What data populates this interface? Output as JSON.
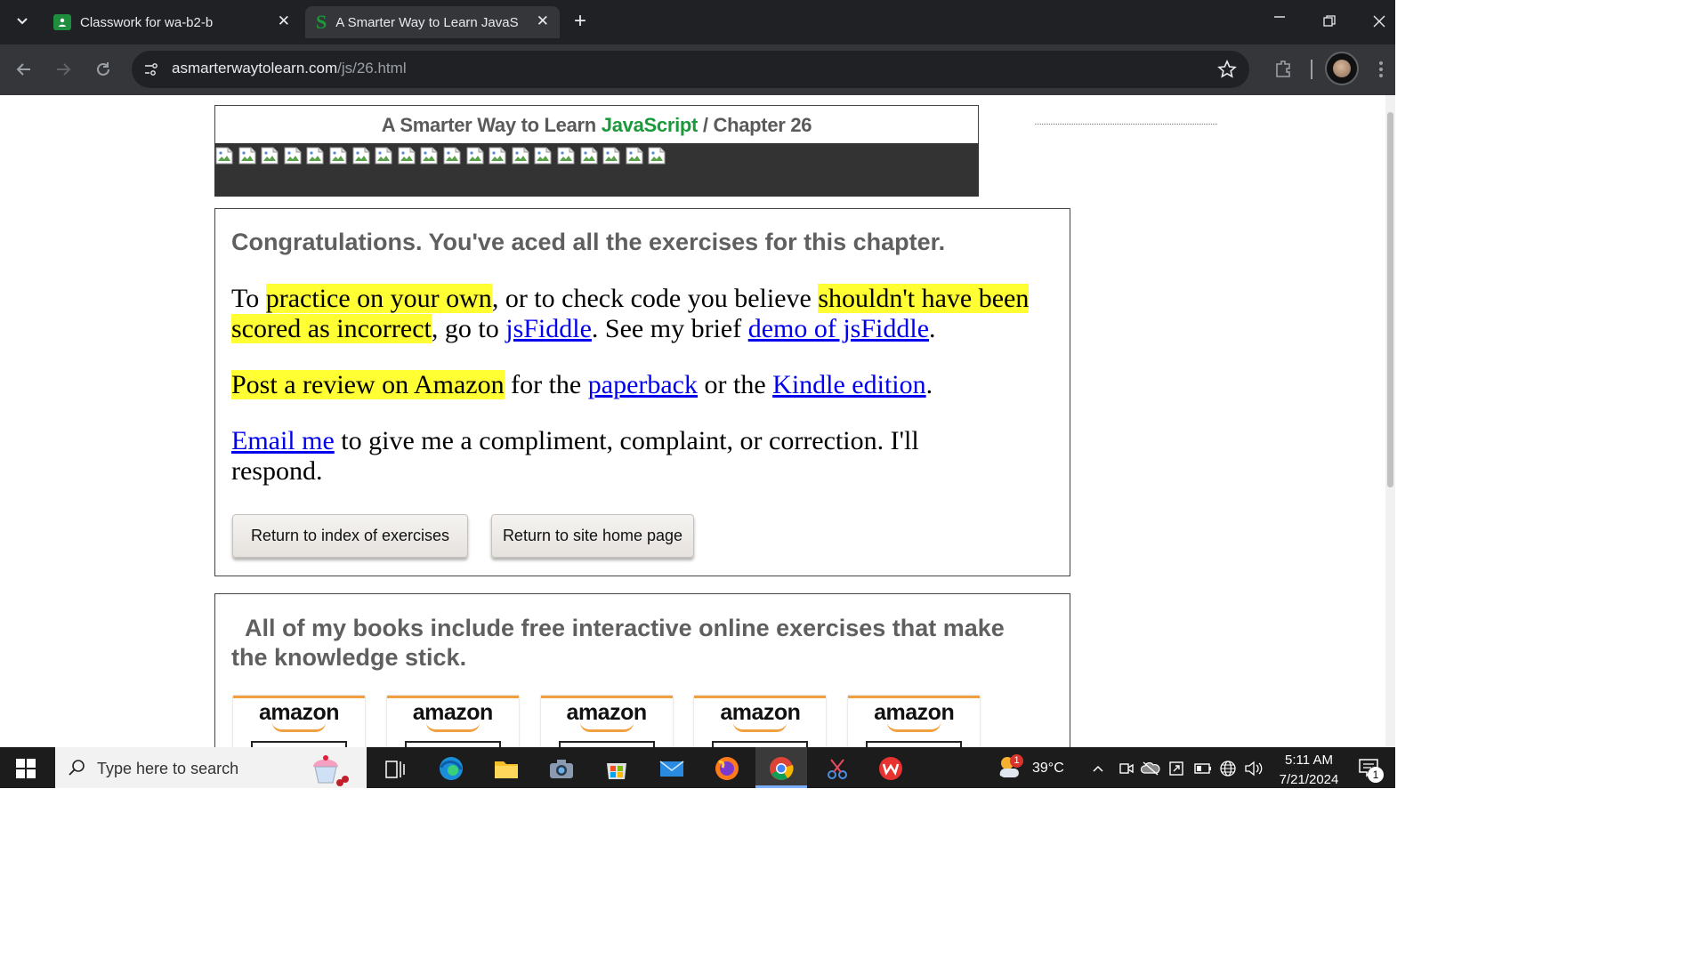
{
  "browser": {
    "tabs": [
      {
        "title": "Classwork for wa-b2-b",
        "close": "✕"
      },
      {
        "title": "A Smarter Way to Learn JavaScri",
        "close": "✕"
      }
    ],
    "new_tab": "+",
    "url_domain": "asmarterwaytolearn.com",
    "url_path": "/js/26.html"
  },
  "header": {
    "prefix": "A Smarter Way to Learn ",
    "brand": "JavaScript",
    "separator": " / ",
    "chapter": "Chapter 26",
    "brand_color": "#1a9a3a"
  },
  "result": {
    "heading": "Congratulations. You've aced all the exercises for this chapter.",
    "p1_a": "To ",
    "p1_hl1": "practice on your own",
    "p1_b": ", or to check code you believe ",
    "p1_hl2": "shouldn't have been scored as incorrect",
    "p1_c": ", go to ",
    "p1_link1": "jsFiddle",
    "p1_d": ". See my brief ",
    "p1_link2": "demo of jsFiddle",
    "p1_e": ".",
    "p2_hl": "Post a review on Amazon",
    "p2_a": " for the ",
    "p2_link1": "paperback",
    "p2_b": " or the ",
    "p2_link2": "Kindle edition",
    "p2_c": ".",
    "p3_link": "Email me",
    "p3_a": " to give me a compliment, complaint, or correction. I'll respond.",
    "btn_index": "Return to index of exercises",
    "btn_home": "Return to site home page"
  },
  "books": {
    "heading": "All of my books include free interactive online exercises that make the knowledge stick.",
    "store_label": "amazon",
    "store_count": 5
  },
  "taskbar": {
    "search_placeholder": "Type here to search",
    "weather_temp": "39°C",
    "weather_badge": "1",
    "time": "5:11 AM",
    "date": "7/21/2024",
    "notification_count": "1"
  }
}
